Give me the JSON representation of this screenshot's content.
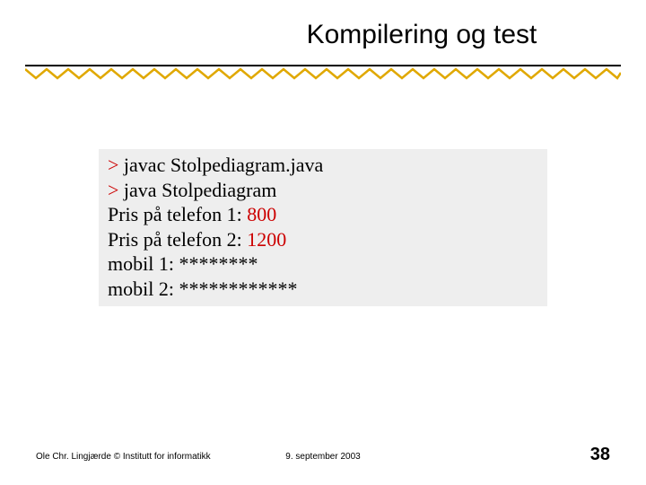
{
  "title": "Kompilering og test",
  "terminal": {
    "lines": [
      {
        "prompt": ">",
        "cmd_a": "javac",
        "cmd_b": "Stolpediagram.",
        "cmd_c": "java"
      },
      {
        "prompt": ">",
        "cmd_a": "java",
        "cmd_b": "Stolpediagram",
        "cmd_c": ""
      }
    ],
    "io": [
      {
        "label": "Pris på telefon 1: ",
        "value": "800"
      },
      {
        "label": "Pris på telefon 2: ",
        "value": "1200"
      },
      {
        "label": "mobil 1: ",
        "value": "********"
      },
      {
        "label": "mobil 2: ",
        "value": "************"
      }
    ]
  },
  "footer": {
    "left": "Ole Chr. Lingjærde © Institutt for informatikk",
    "center": "9. september 2003",
    "right": "38"
  },
  "colors": {
    "accent": "#e0a800",
    "prompt": "#cc0000"
  }
}
